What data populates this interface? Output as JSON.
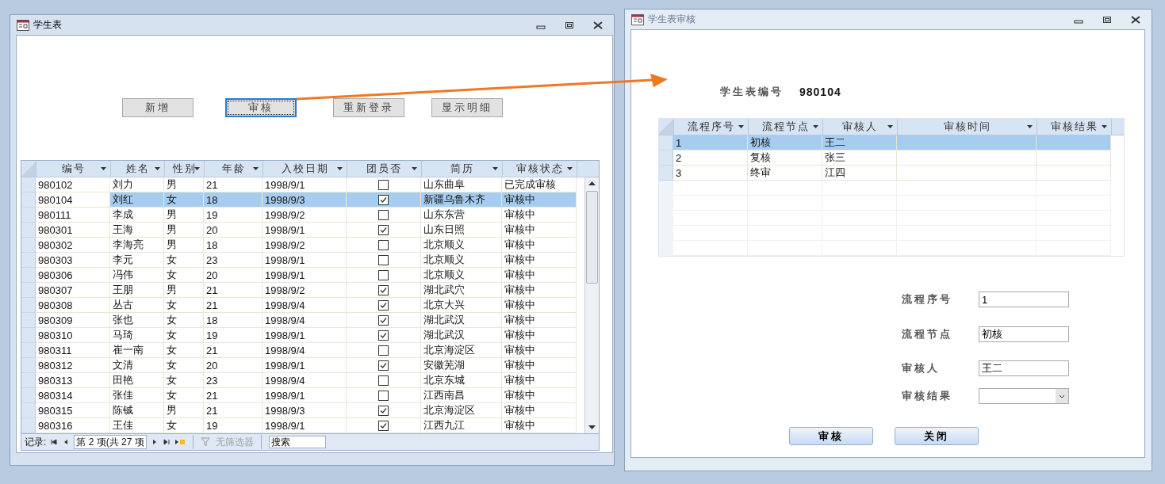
{
  "left_window": {
    "title": "学生表",
    "active": true,
    "buttons": [
      {
        "label": "新增",
        "focused": false
      },
      {
        "label": "审核",
        "focused": true
      },
      {
        "label": "重新登录",
        "focused": false
      },
      {
        "label": "显示明细",
        "focused": false
      }
    ],
    "table": {
      "columns": [
        "编号",
        "姓名",
        "性别",
        "年龄",
        "入校日期",
        "团员否",
        "简历",
        "审核状态"
      ],
      "rows": [
        {
          "cells": [
            "980102",
            "刘力",
            "男",
            "21",
            "1998/9/1"
          ],
          "member": false,
          "resume": "山东曲阜",
          "status": "已完成审核",
          "selected": false
        },
        {
          "cells": [
            "980104",
            "刘红",
            "女",
            "18",
            "1998/9/3"
          ],
          "member": true,
          "resume": "新疆乌鲁木齐",
          "status": "审核中",
          "selected": true
        },
        {
          "cells": [
            "980111",
            "李成",
            "男",
            "19",
            "1998/9/2"
          ],
          "member": false,
          "resume": "山东东营",
          "status": "审核中",
          "selected": false
        },
        {
          "cells": [
            "980301",
            "王海",
            "男",
            "20",
            "1998/9/1"
          ],
          "member": true,
          "resume": "山东日照",
          "status": "审核中",
          "selected": false
        },
        {
          "cells": [
            "980302",
            "李海亮",
            "男",
            "18",
            "1998/9/2"
          ],
          "member": false,
          "resume": "北京顺义",
          "status": "审核中",
          "selected": false
        },
        {
          "cells": [
            "980303",
            "李元",
            "女",
            "23",
            "1998/9/1"
          ],
          "member": false,
          "resume": "北京顺义",
          "status": "审核中",
          "selected": false
        },
        {
          "cells": [
            "980306",
            "冯伟",
            "女",
            "20",
            "1998/9/1"
          ],
          "member": false,
          "resume": "北京顺义",
          "status": "审核中",
          "selected": false
        },
        {
          "cells": [
            "980307",
            "王朋",
            "男",
            "21",
            "1998/9/2"
          ],
          "member": true,
          "resume": "湖北武穴",
          "status": "审核中",
          "selected": false
        },
        {
          "cells": [
            "980308",
            "丛古",
            "女",
            "21",
            "1998/9/4"
          ],
          "member": true,
          "resume": "北京大兴",
          "status": "审核中",
          "selected": false
        },
        {
          "cells": [
            "980309",
            "张也",
            "女",
            "18",
            "1998/9/4"
          ],
          "member": true,
          "resume": "湖北武汉",
          "status": "审核中",
          "selected": false
        },
        {
          "cells": [
            "980310",
            "马琦",
            "女",
            "19",
            "1998/9/1"
          ],
          "member": true,
          "resume": "湖北武汉",
          "status": "审核中",
          "selected": false
        },
        {
          "cells": [
            "980311",
            "崔一南",
            "女",
            "21",
            "1998/9/4"
          ],
          "member": false,
          "resume": "北京海淀区",
          "status": "审核中",
          "selected": false
        },
        {
          "cells": [
            "980312",
            "文清",
            "女",
            "20",
            "1998/9/1"
          ],
          "member": true,
          "resume": "安徽芜湖",
          "status": "审核中",
          "selected": false
        },
        {
          "cells": [
            "980313",
            "田艳",
            "女",
            "23",
            "1998/9/4"
          ],
          "member": false,
          "resume": "北京东城",
          "status": "审核中",
          "selected": false
        },
        {
          "cells": [
            "980314",
            "张佳",
            "女",
            "21",
            "1998/9/1"
          ],
          "member": false,
          "resume": "江西南昌",
          "status": "审核中",
          "selected": false
        },
        {
          "cells": [
            "980315",
            "陈铖",
            "男",
            "21",
            "1998/9/3"
          ],
          "member": true,
          "resume": "北京海淀区",
          "status": "审核中",
          "selected": false
        },
        {
          "cells": [
            "980316",
            "王佳",
            "女",
            "19",
            "1998/9/1"
          ],
          "member": true,
          "resume": "江西九江",
          "status": "审核中",
          "selected": false
        }
      ]
    },
    "navigator": {
      "label": "记录:",
      "position": "第 2 项(共 27 项",
      "filter": {
        "label": "无筛选器",
        "disabled": true
      },
      "search": {
        "placeholder": "搜索"
      }
    }
  },
  "right_window": {
    "title": "学生表审核",
    "active": false,
    "id_label": "学生表编号",
    "id_value": "980104",
    "table": {
      "columns": [
        "流程序号",
        "流程节点",
        "审核人",
        "审核时间",
        "审核结果"
      ],
      "rows": [
        {
          "seq": "1",
          "node": "初核",
          "reviewer": "王二",
          "selected": true
        },
        {
          "seq": "2",
          "node": "复核",
          "reviewer": "张三",
          "selected": false
        },
        {
          "seq": "3",
          "node": "终审",
          "reviewer": "江四",
          "selected": false
        }
      ]
    },
    "form": {
      "fields": [
        {
          "kind": "text",
          "label": "流程序号",
          "value": "1"
        },
        {
          "kind": "text",
          "label": "流程节点",
          "value": "初核"
        },
        {
          "kind": "text",
          "label": "审核人",
          "value": "王二"
        },
        {
          "kind": "dropdown",
          "label": "审核结果"
        }
      ]
    },
    "buttons": [
      {
        "label": "审核"
      },
      {
        "label": "关闭"
      }
    ]
  }
}
